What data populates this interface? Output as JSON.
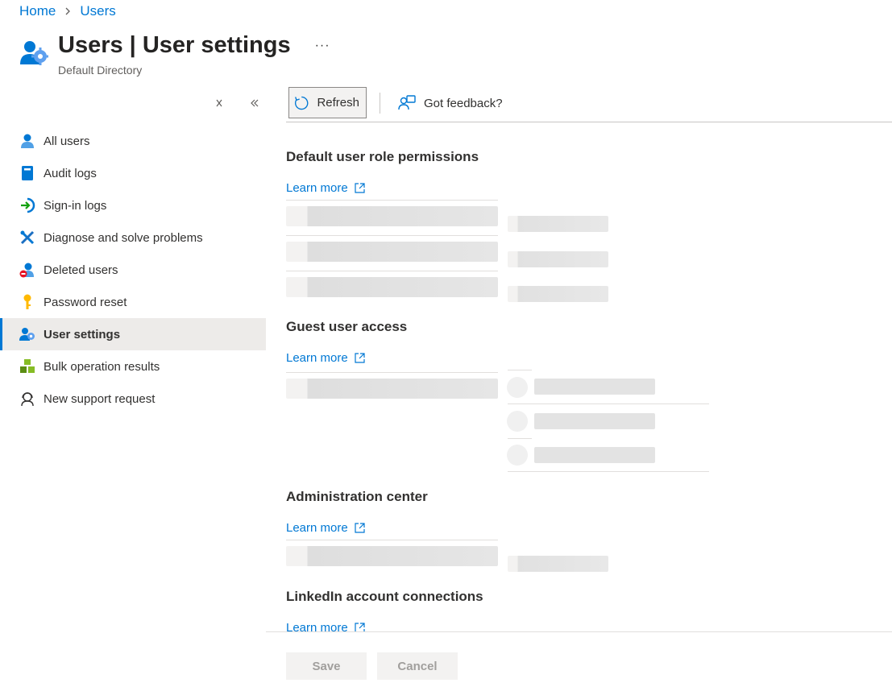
{
  "breadcrumb": {
    "home": "Home",
    "users": "Users"
  },
  "header": {
    "title_bold": "Users",
    "title_rest": " | User settings",
    "more": "···",
    "subtitle": "Default Directory"
  },
  "sidebar": {
    "items": [
      {
        "label": "All users",
        "icon": "user-icon"
      },
      {
        "label": "Audit logs",
        "icon": "book-icon"
      },
      {
        "label": "Sign-in logs",
        "icon": "sign-in-icon"
      },
      {
        "label": "Diagnose and solve problems",
        "icon": "wrench-icon"
      },
      {
        "label": "Deleted users",
        "icon": "deleted-user-icon"
      },
      {
        "label": "Password reset",
        "icon": "key-icon"
      },
      {
        "label": "User settings",
        "icon": "user-gear-icon",
        "active": true
      },
      {
        "label": "Bulk operation results",
        "icon": "cubes-icon"
      },
      {
        "label": "New support request",
        "icon": "support-icon"
      }
    ]
  },
  "toolbar": {
    "refresh": "Refresh",
    "feedback": "Got feedback?"
  },
  "sections": [
    {
      "title": "Default user role permissions",
      "learn_more": "Learn more"
    },
    {
      "title": "Guest user access",
      "learn_more": "Learn more"
    },
    {
      "title": "Administration center",
      "learn_more": "Learn more"
    },
    {
      "title": "LinkedIn account connections",
      "learn_more": "Learn more"
    }
  ],
  "footer": {
    "save": "Save",
    "cancel": "Cancel"
  },
  "colors": {
    "accent": "#0078d4",
    "active_bg": "#edebe9",
    "text": "#323130"
  }
}
